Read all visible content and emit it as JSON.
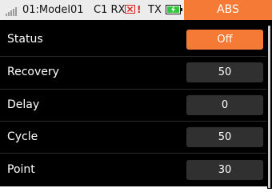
{
  "statusbar": {
    "model": "01:Model01",
    "rx_label": "C1 RX",
    "rx_warning": "!",
    "tx_label": "TX",
    "icons": {
      "signal": "signal-bars-icon",
      "rx_status": "disconnected-x-icon",
      "tx_battery": "battery-charging-icon"
    }
  },
  "title": "ABS",
  "rows": [
    {
      "label": "Status",
      "value": "Off"
    },
    {
      "label": "Recovery",
      "value": "50"
    },
    {
      "label": "Delay",
      "value": "0"
    },
    {
      "label": "Cycle",
      "value": "50"
    },
    {
      "label": "Point",
      "value": "30"
    }
  ],
  "colors": {
    "accent": "#f47a36",
    "background": "#000000",
    "value_box": "#303030",
    "statusbar": "#ececec",
    "battery": "#32c83c",
    "warning": "#e02020"
  }
}
